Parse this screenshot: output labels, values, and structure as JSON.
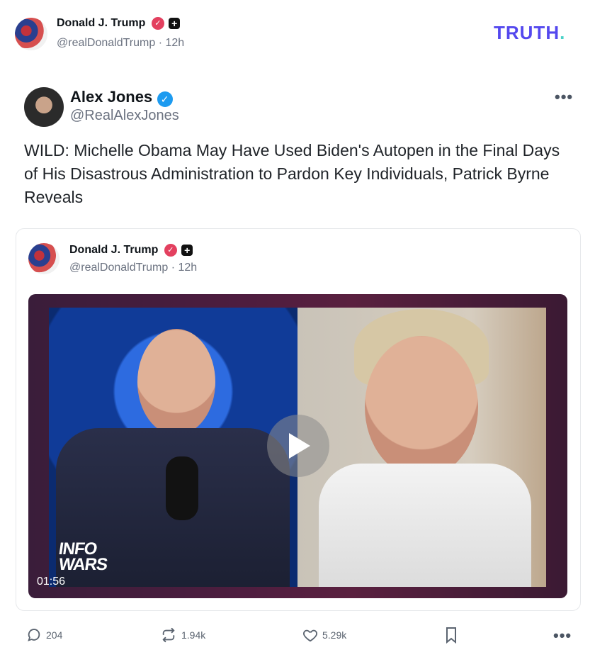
{
  "header": {
    "author_name": "Donald J. Trump",
    "author_handle": "@realDonaldTrump",
    "time": "12h",
    "separator": "·",
    "logo_text": "TRUTH",
    "logo_dot": "."
  },
  "quoted_post": {
    "author_name": "Alex Jones",
    "author_handle": "@RealAlexJones",
    "text": "WILD: Michelle Obama May Have Used Biden's Autopen in the Final Days of His Disastrous Administration to Pardon Key Individuals, Patrick Byrne Reveals"
  },
  "embedded_card": {
    "author_name": "Donald J. Trump",
    "author_handle": "@realDonaldTrump",
    "time": "12h",
    "separator": "·",
    "video": {
      "duration": "01:56",
      "watermark_line1": "INFO",
      "watermark_line2": "WARS"
    }
  },
  "actions": {
    "replies": "204",
    "retruths": "1.94k",
    "likes": "5.29k"
  },
  "icons": {
    "verified_red": "verified-badge-icon",
    "verified_blue": "verified-badge-icon",
    "plus": "plus-badge-icon",
    "more": "more-options-icon",
    "reply": "reply-icon",
    "retruth": "retruth-icon",
    "like": "heart-icon",
    "bookmark": "bookmark-icon",
    "play": "play-icon"
  },
  "colors": {
    "logo": "#5448ee",
    "logo_dot": "#4bd2c8",
    "verified_red": "#e3405f",
    "verified_blue": "#1d9bf0"
  }
}
